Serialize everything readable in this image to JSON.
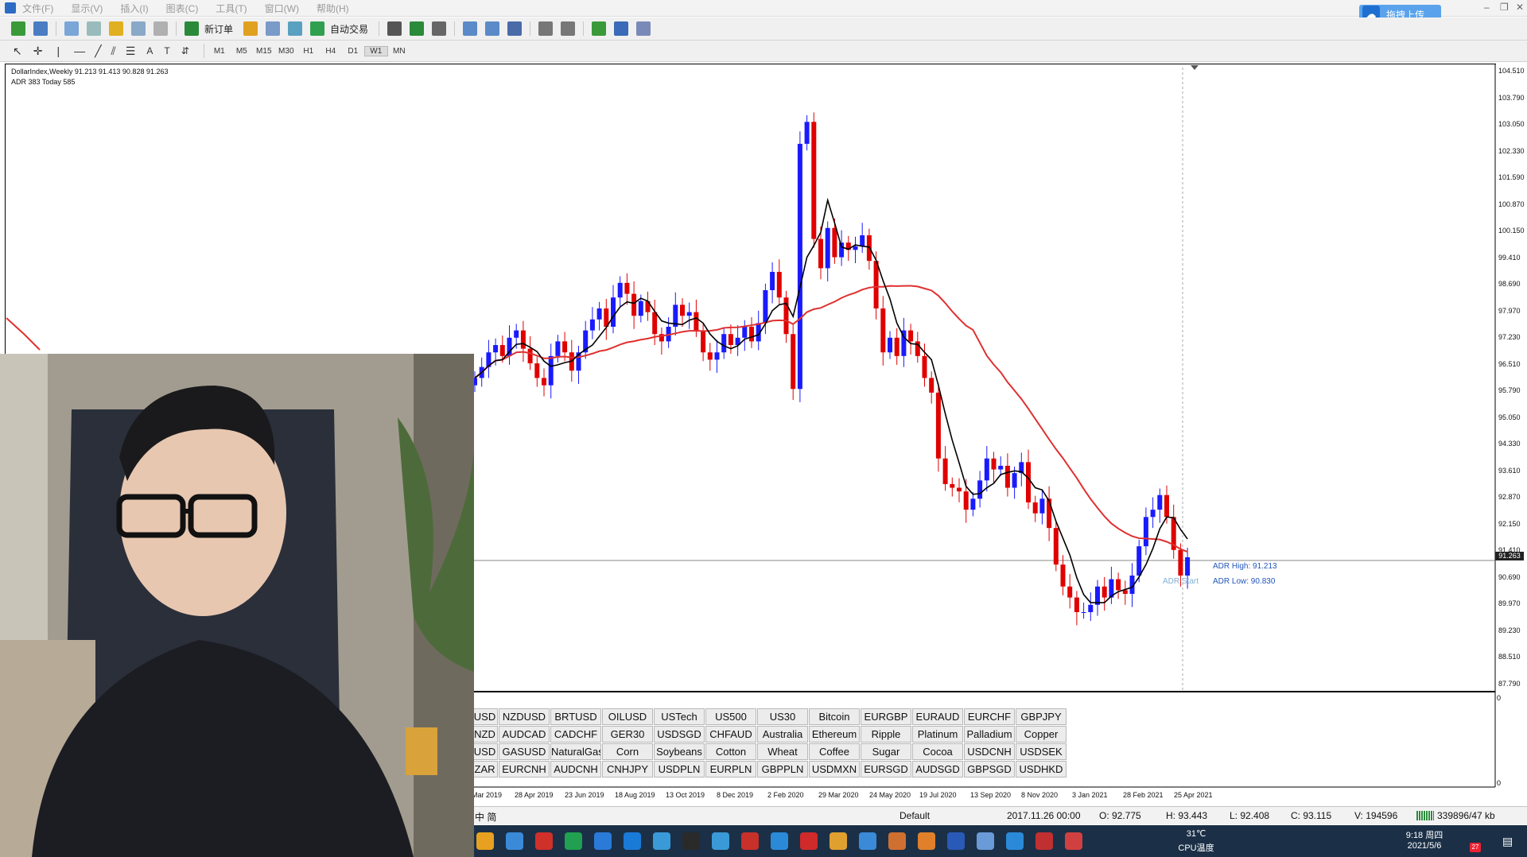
{
  "menu": [
    "文件(F)",
    "显示(V)",
    "插入(I)",
    "图表(C)",
    "工具(T)",
    "窗口(W)",
    "帮助(H)"
  ],
  "cloud_button": {
    "label": "拖拽上传"
  },
  "toolbar": {
    "new_order": "新订单",
    "auto_trade": "自动交易"
  },
  "timeframes": [
    "M1",
    "M5",
    "M15",
    "M30",
    "H1",
    "H4",
    "D1",
    "W1",
    "MN"
  ],
  "active_timeframe": "W1",
  "chart": {
    "symbol_line": "DollarIndex,Weekly  91.213 91.413 90.828 91.263",
    "adr_line": "ADR 383  Today 585",
    "current_price": "91.263",
    "adr_high": "ADR High: 91.213",
    "adr_low": "ADR Low: 90.830",
    "adr_start": "ADR Start",
    "sub_axis_top": "0",
    "sub_axis_bottom": "0"
  },
  "price_ticks": [
    "104.510",
    "103.790",
    "103.050",
    "102.330",
    "101.590",
    "100.870",
    "100.150",
    "99.410",
    "98.690",
    "97.970",
    "97.230",
    "96.510",
    "95.790",
    "95.050",
    "94.330",
    "93.610",
    "92.870",
    "92.150",
    "91.410",
    "90.690",
    "89.970",
    "89.230",
    "88.510",
    "87.790"
  ],
  "date_labels": [
    "Mar 2019",
    "28 Apr 2019",
    "23 Jun 2019",
    "18 Aug 2019",
    "13 Oct 2019",
    "8 Dec 2019",
    "2 Feb 2020",
    "29 Mar 2020",
    "24 May 2020",
    "19 Jul 2020",
    "13 Sep 2020",
    "8 Nov 2020",
    "3 Jan 2021",
    "28 Feb 2021",
    "25 Apr 2021"
  ],
  "symbols": [
    [
      "USD",
      "NZDUSD",
      "BRTUSD",
      "OILUSD",
      "USTech",
      "US500",
      "US30",
      "Bitcoin",
      "EURGBP",
      "EURAUD",
      "EURCHF",
      "GBPJPY"
    ],
    [
      "NZD",
      "AUDCAD",
      "CADCHF",
      "GER30",
      "USDSGD",
      "CHFAUD",
      "Australia",
      "Ethereum",
      "Ripple",
      "Platinum",
      "Palladium",
      "Copper"
    ],
    [
      "USD",
      "GASUSD",
      "NaturalGas",
      "Corn",
      "Soybeans",
      "Cotton",
      "Wheat",
      "Coffee",
      "Sugar",
      "Cocoa",
      "USDCNH",
      "USDSEK"
    ],
    [
      "ZAR",
      "EURCNH",
      "AUDCNH",
      "CNHJPY",
      "USDPLN",
      "EURPLN",
      "GBPPLN",
      "USDMXN",
      "EURSGD",
      "AUDSGD",
      "GBPSGD",
      "USDHKD"
    ]
  ],
  "status": {
    "profile": "Default",
    "datetime": "2017.11.26 00:00",
    "open": "O: 92.775",
    "high": "H: 93.443",
    "low": "L: 92.408",
    "close": "C: 93.115",
    "volume": "V: 194596",
    "traffic": "339896/47 kb"
  },
  "ime": "中  简",
  "taskbar": {
    "temperature": "31℃",
    "temp_label": "CPU温度",
    "time": "9:18 周四",
    "date": "2021/5/6",
    "badge": "27"
  },
  "colors": {
    "bull": "#1a1aff",
    "bear": "#e00000",
    "ma_slow": "#e03030",
    "ma_fast": "#000000"
  }
}
